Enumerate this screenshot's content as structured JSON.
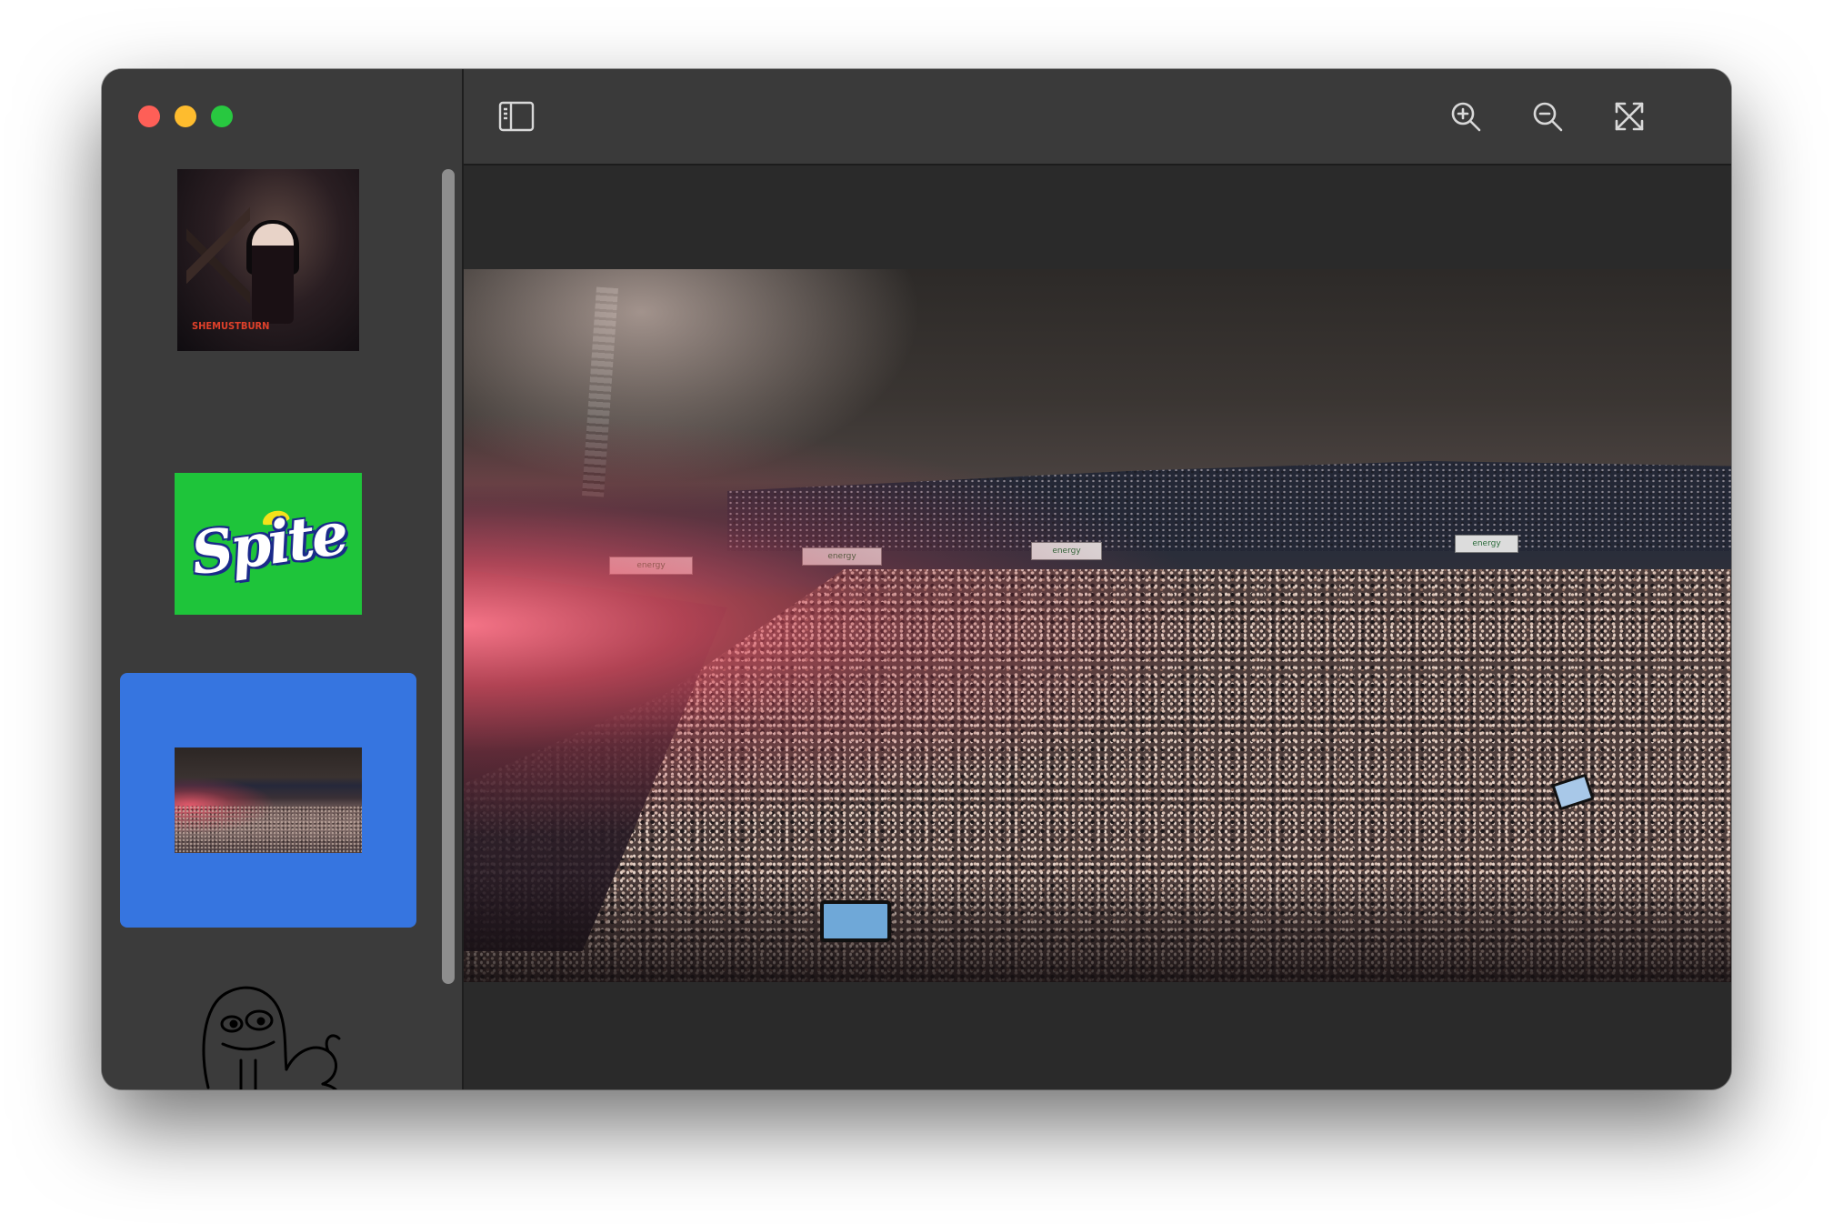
{
  "window": {
    "title": ""
  },
  "colors": {
    "close": "#fe5f57",
    "minimize": "#febc2e",
    "zoom": "#28c840",
    "selection": "#3675e0",
    "sidebar_bg": "#3b3b3b",
    "viewer_bg": "#2a2a2a"
  },
  "toolbar": {
    "sidebar_toggle_icon": "sidebar-left-icon",
    "zoom_in_icon": "zoom-in-icon",
    "zoom_out_icon": "zoom-out-icon",
    "fullscreen_icon": "arrows-expand-icon"
  },
  "sidebar": {
    "items": [
      {
        "name": "album-art",
        "selected": false,
        "album_text": "SHEMUSTBURN",
        "album_subtext": ""
      },
      {
        "name": "spite-logo",
        "selected": false,
        "logo_text": "Spite"
      },
      {
        "name": "concert-photo",
        "selected": true
      },
      {
        "name": "sketch-drawing",
        "selected": false
      }
    ]
  },
  "viewer": {
    "image": "concert-crowd-photo",
    "banner_text": "energy"
  }
}
